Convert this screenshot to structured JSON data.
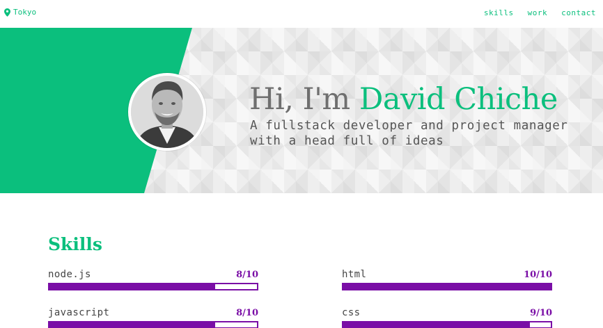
{
  "location": {
    "city": "Tokyo",
    "icon": "map-pin-icon"
  },
  "nav": [
    {
      "label": "skills"
    },
    {
      "label": "work"
    },
    {
      "label": "contact"
    }
  ],
  "hero": {
    "greeting": "Hi, I'm ",
    "name": "David Chiche",
    "subtitle": "A fullstack developer and project manager with a head full of ideas"
  },
  "skills": {
    "title": "Skills",
    "items": [
      {
        "label": "node.js",
        "score": "8/10",
        "level": 0.8
      },
      {
        "label": "html",
        "score": "10/10",
        "level": 1.0
      },
      {
        "label": "javascript",
        "score": "8/10",
        "level": 0.8
      },
      {
        "label": "css",
        "score": "9/10",
        "level": 0.9
      }
    ]
  },
  "colors": {
    "accent": "#0bbf7d",
    "skill_bar": "#7a0ea6",
    "heading_gray": "#6f6f6f"
  }
}
